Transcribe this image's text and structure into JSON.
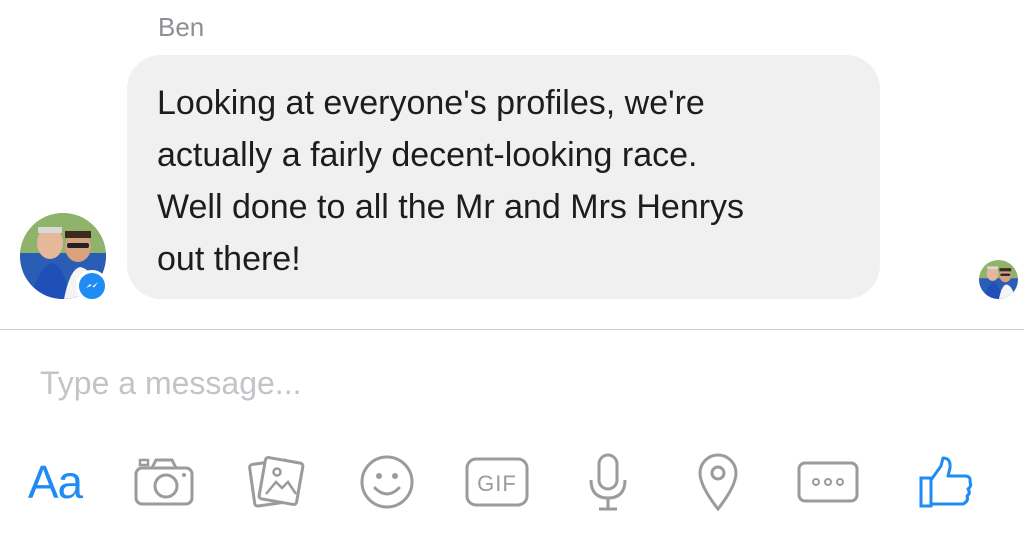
{
  "conversation": {
    "sender_name": "Ben",
    "message_lines": [
      "Looking at everyone's profiles, we're",
      "actually a fairly decent-looking race.",
      "Well done to all the Mr and Mrs Henrys",
      "out there!"
    ]
  },
  "composer": {
    "placeholder": "Type a message..."
  },
  "toolbar": {
    "text_button_label": "Aa",
    "gif_label": "GIF",
    "icons": [
      "camera-icon",
      "photo-gallery-icon",
      "emoji-icon",
      "gif-icon",
      "microphone-icon",
      "location-icon",
      "more-icon",
      "thumbs-up-icon"
    ]
  },
  "colors": {
    "accent": "#1f8cf5",
    "bubble": "#f1f0f0",
    "icon_gray": "#9b9b9f",
    "placeholder": "#c4c4c8",
    "text": "#1d1d1d"
  }
}
